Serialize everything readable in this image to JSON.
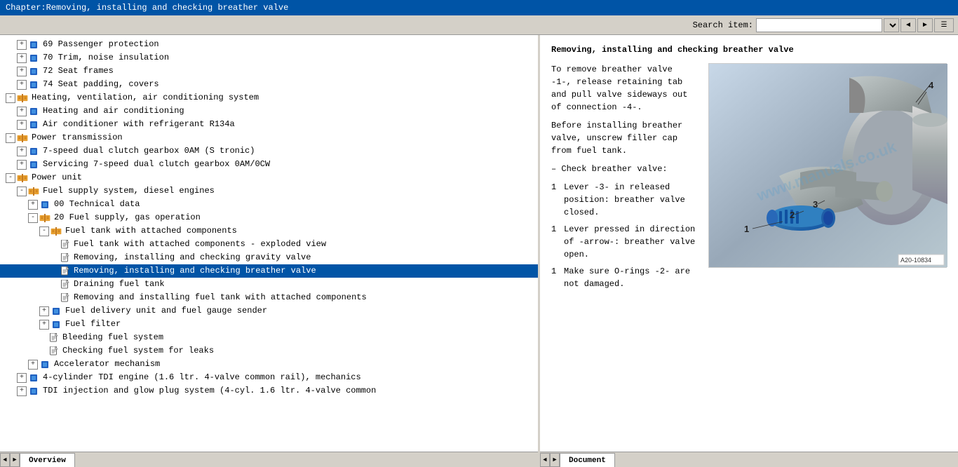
{
  "title_bar": {
    "text": "Chapter:Removing, installing and checking breather valve"
  },
  "toolbar": {
    "search_label": "Search item:",
    "search_placeholder": "",
    "search_value": ""
  },
  "tree": {
    "items": [
      {
        "id": 1,
        "level": 2,
        "type": "folder-expand",
        "text": "69 Passenger protection",
        "expanded": true
      },
      {
        "id": 2,
        "level": 2,
        "type": "folder-expand",
        "text": "70 Trim, noise insulation",
        "expanded": true
      },
      {
        "id": 3,
        "level": 2,
        "type": "folder-expand",
        "text": "72 Seat frames",
        "expanded": true
      },
      {
        "id": 4,
        "level": 2,
        "type": "folder-expand",
        "text": "74 Seat padding, covers",
        "expanded": true
      },
      {
        "id": 5,
        "level": 1,
        "type": "folder-open",
        "text": "Heating, ventilation, air conditioning system",
        "expanded": true
      },
      {
        "id": 6,
        "level": 2,
        "type": "folder-expand",
        "text": "Heating and air conditioning",
        "expanded": false
      },
      {
        "id": 7,
        "level": 2,
        "type": "folder-expand",
        "text": "Air conditioner with refrigerant R134a",
        "expanded": false
      },
      {
        "id": 8,
        "level": 1,
        "type": "folder-open",
        "text": "Power transmission",
        "expanded": true
      },
      {
        "id": 9,
        "level": 2,
        "type": "folder-expand",
        "text": "7-speed dual clutch gearbox 0AM (S tronic)",
        "expanded": false
      },
      {
        "id": 10,
        "level": 2,
        "type": "folder-expand",
        "text": "Servicing 7-speed dual clutch gearbox 0AM/0CW",
        "expanded": false
      },
      {
        "id": 11,
        "level": 1,
        "type": "folder-open",
        "text": "Power unit",
        "expanded": true
      },
      {
        "id": 12,
        "level": 2,
        "type": "folder-open",
        "text": "Fuel supply system, diesel engines",
        "expanded": true
      },
      {
        "id": 13,
        "level": 3,
        "type": "folder-expand",
        "text": "00 Technical data",
        "expanded": false
      },
      {
        "id": 14,
        "level": 3,
        "type": "folder-open",
        "text": "20 Fuel supply, gas operation",
        "expanded": true
      },
      {
        "id": 15,
        "level": 4,
        "type": "folder-open",
        "text": "Fuel tank with attached components",
        "expanded": true
      },
      {
        "id": 16,
        "level": 5,
        "type": "doc",
        "text": "Fuel tank with attached components - exploded view",
        "selected": false
      },
      {
        "id": 17,
        "level": 5,
        "type": "doc",
        "text": "Removing, installing and checking gravity valve",
        "selected": false
      },
      {
        "id": 18,
        "level": 5,
        "type": "doc",
        "text": "Removing, installing and checking breather valve",
        "selected": true
      },
      {
        "id": 19,
        "level": 5,
        "type": "doc",
        "text": "Draining fuel tank",
        "selected": false
      },
      {
        "id": 20,
        "level": 5,
        "type": "doc",
        "text": "Removing and installing fuel tank with attached components",
        "selected": false
      },
      {
        "id": 21,
        "level": 4,
        "type": "folder-expand",
        "text": "Fuel delivery unit and fuel gauge sender",
        "expanded": false
      },
      {
        "id": 22,
        "level": 4,
        "type": "folder-expand",
        "text": "Fuel filter",
        "expanded": false
      },
      {
        "id": 23,
        "level": 4,
        "type": "doc-plain",
        "text": "Bleeding fuel system",
        "selected": false
      },
      {
        "id": 24,
        "level": 4,
        "type": "doc-plain",
        "text": "Checking fuel system for leaks",
        "selected": false
      },
      {
        "id": 25,
        "level": 3,
        "type": "folder-expand",
        "text": "Accelerator mechanism",
        "expanded": false
      },
      {
        "id": 26,
        "level": 2,
        "type": "folder-expand",
        "text": "4-cylinder TDI engine (1.6 ltr. 4-valve common rail), mechanics",
        "expanded": false
      },
      {
        "id": 27,
        "level": 2,
        "type": "folder-expand",
        "text": "TDI injection and glow plug system (4-cyl. 1.6 ltr. 4-valve common",
        "expanded": false
      }
    ]
  },
  "document": {
    "title": "Removing, installing and checking breather valve",
    "image_ref": "A20-10834",
    "image_labels": [
      "1",
      "2",
      "3",
      "4"
    ],
    "watermark": "www.manuals.co.uk",
    "paragraphs": [
      {
        "type": "heading",
        "text": "To remove breather valve -1-, release retaining tab and pull valve sideways out of connection -4-."
      },
      {
        "type": "heading",
        "text": "Before installing breather valve, unscrew filler cap from fuel tank."
      },
      {
        "type": "heading-dash",
        "text": "Check breather valve:"
      },
      {
        "type": "numbered",
        "num": "1",
        "text": "Lever -3- in released position: breather valve closed."
      },
      {
        "type": "numbered",
        "num": "1",
        "text": "Lever pressed in direction of -arrow-: breather valve open."
      },
      {
        "type": "numbered",
        "num": "1",
        "text": "Make sure O-rings -2- are not damaged."
      }
    ]
  },
  "tabs": {
    "left": {
      "label": "Overview",
      "active": true
    },
    "right": {
      "label": "Document",
      "active": true
    }
  },
  "icons": {
    "expand_plus": "+",
    "collapse_minus": "-",
    "arrow_left": "◄",
    "arrow_right": "►",
    "arrow_up": "▲",
    "arrow_down": "▼",
    "search_icon": "🔍",
    "user_icon": "👤",
    "settings_icon": "⚙"
  }
}
